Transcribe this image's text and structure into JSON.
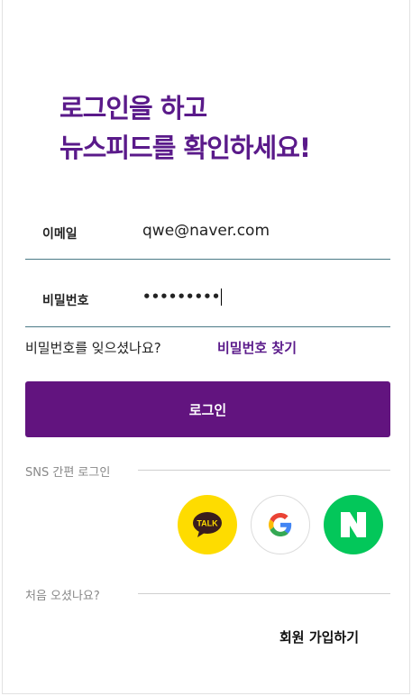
{
  "headline": {
    "line1": "로그인을 하고",
    "line2": "뉴스피드를 확인하세요!"
  },
  "email": {
    "label": "이메일",
    "value": "qwe@naver.com"
  },
  "password": {
    "label": "비밀번호",
    "masked_value": "•••••••••"
  },
  "forgot": {
    "text": "비밀번호를 잊으셨나요?",
    "link": "비밀번호 찾기"
  },
  "login_button": "로그인",
  "sns": {
    "label": "SNS 간편 로그인",
    "kakao_text": "TALK",
    "providers": [
      "kakao-talk-icon",
      "google-icon",
      "naver-icon"
    ]
  },
  "signup": {
    "label": "처음 오셨나요?",
    "link": "회원 가입하기"
  },
  "colors": {
    "brand": "#62147f",
    "headline": "#5a1a8a",
    "kakao": "#fedc00",
    "naver": "#03c75a",
    "underline": "#4a7a86"
  }
}
